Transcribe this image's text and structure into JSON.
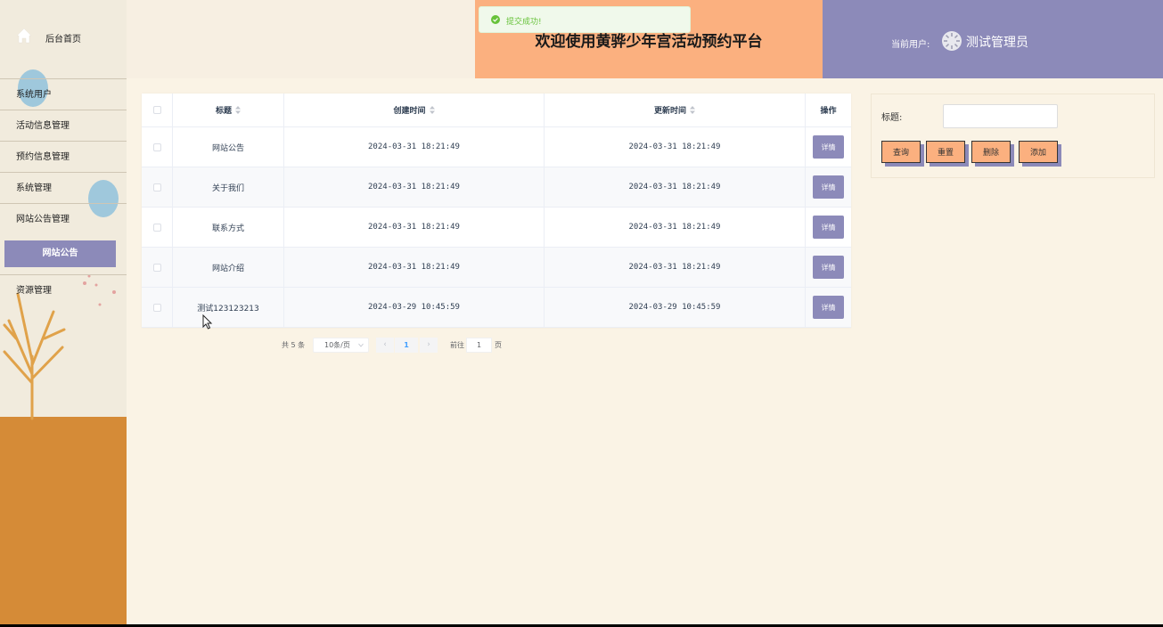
{
  "sidebar": {
    "home_label": "后台首页",
    "items": [
      {
        "label": "系统用户"
      },
      {
        "label": "活动信息管理"
      },
      {
        "label": "预约信息管理"
      },
      {
        "label": "系统管理"
      },
      {
        "label": "网站公告管理"
      },
      {
        "label": "资源管理"
      }
    ],
    "active_sub": "网站公告"
  },
  "header": {
    "title": "欢迎使用黄骅少年宫活动预约平台",
    "user_label": "当前用户:",
    "user_name": "测试管理员"
  },
  "toast": {
    "text": "提交成功!"
  },
  "table": {
    "columns": [
      "标题",
      "创建时间",
      "更新时间",
      "操作"
    ],
    "detail_label": "详情",
    "rows": [
      {
        "title": "网站公告",
        "created": "2024-03-31 18:21:49",
        "updated": "2024-03-31 18:21:49"
      },
      {
        "title": "关于我们",
        "created": "2024-03-31 18:21:49",
        "updated": "2024-03-31 18:21:49"
      },
      {
        "title": "联系方式",
        "created": "2024-03-31 18:21:49",
        "updated": "2024-03-31 18:21:49"
      },
      {
        "title": "网站介绍",
        "created": "2024-03-31 18:21:49",
        "updated": "2024-03-31 18:21:49"
      },
      {
        "title": "测试123123213",
        "created": "2024-03-29 10:45:59",
        "updated": "2024-03-29 10:45:59"
      }
    ]
  },
  "pagination": {
    "total": "共 5 条",
    "page_size": "10条/页",
    "prev": "‹",
    "current": "1",
    "next": "›",
    "goto_label": "前往",
    "goto_value": "1",
    "page_suffix": "页"
  },
  "search": {
    "label": "标题:",
    "buttons": {
      "query": "查询",
      "reset": "重置",
      "delete": "删除",
      "add": "添加"
    }
  },
  "colors": {
    "accent_purple": "#8c8ab9",
    "accent_orange": "#fbb07f",
    "ground": "#d58b37",
    "background": "#faf3e5"
  }
}
